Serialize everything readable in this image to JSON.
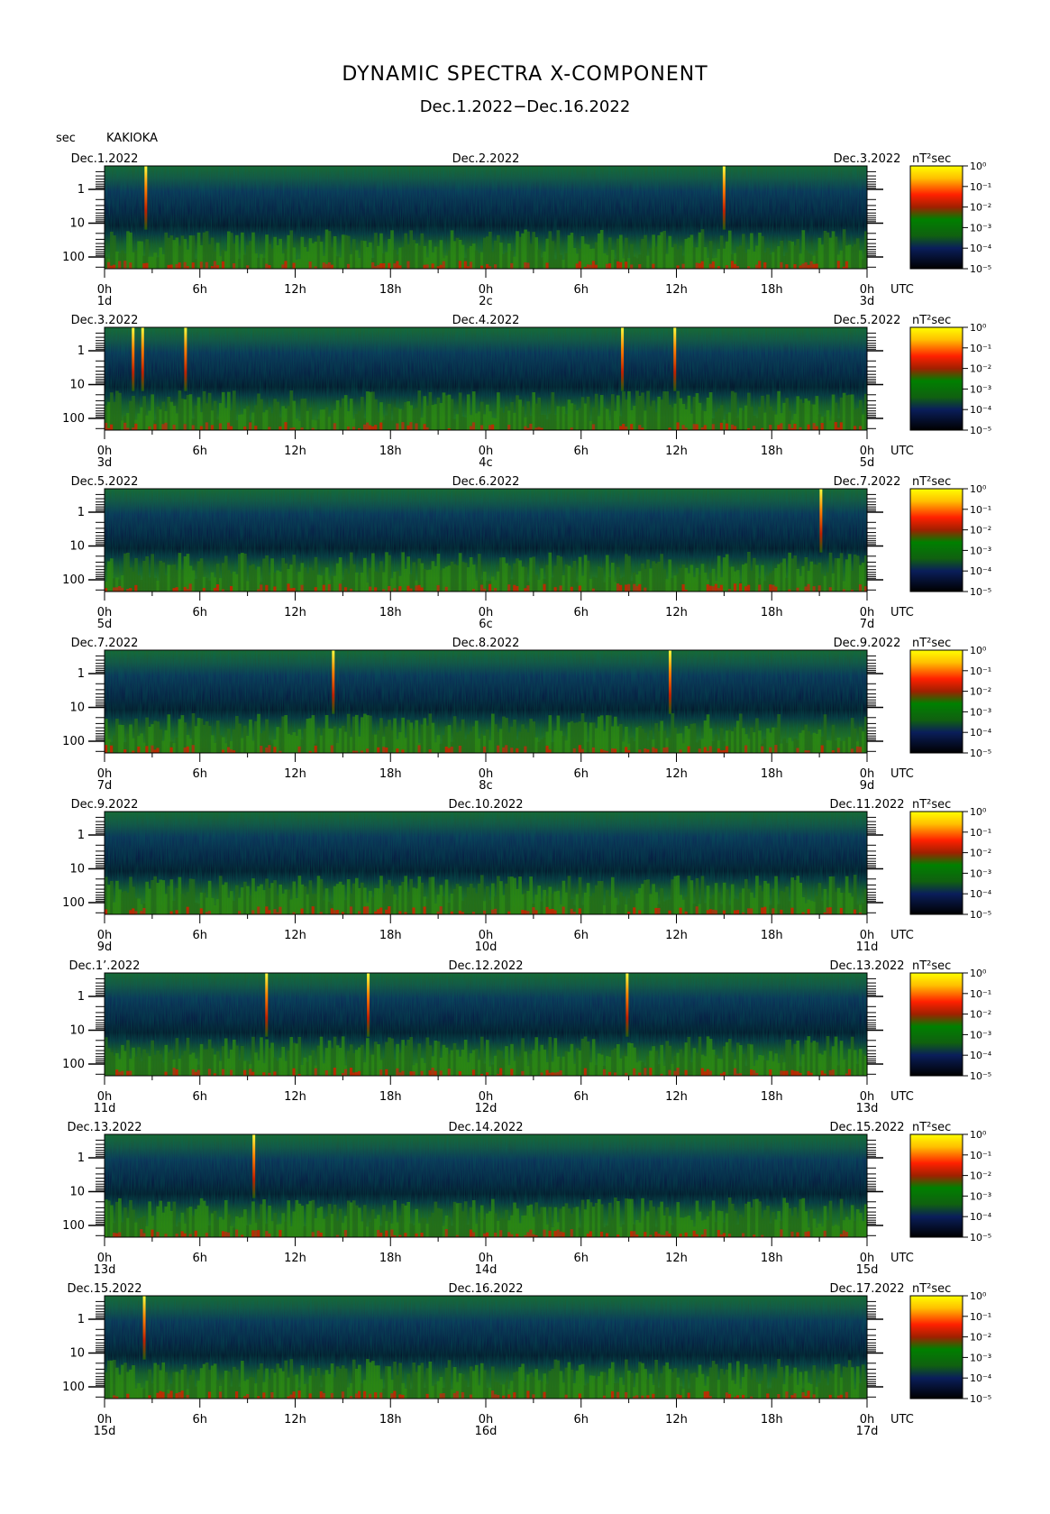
{
  "header": {
    "title": "DYNAMIC SPECTRA X-COMPONENT",
    "subtitle": "Dec.1.2022−Dec.16.2022",
    "y_unit": "sec",
    "station": "KAKIOKA"
  },
  "chart_data": {
    "type": "heatmap",
    "title": "DYNAMIC SPECTRA X-COMPONENT",
    "subtitle": "Dec.1.2022−Dec.16.2022",
    "ylabel": "sec",
    "y_scale": "log",
    "y_ticks": [
      "1",
      "10",
      "100"
    ],
    "x_tick_labels": [
      "0h",
      "6h",
      "12h",
      "18h",
      "0h",
      "6h",
      "12h",
      "18h",
      "0h"
    ],
    "x_unit": "UTC",
    "colorbar": {
      "label": "nT²sec",
      "scale": "log",
      "ticks": [
        "10⁰",
        "10⁻¹",
        "10⁻²",
        "10⁻³",
        "10⁻⁴",
        "10⁻⁵"
      ],
      "colors": [
        "#ffff00",
        "#ff9000",
        "#ff0000",
        "#008000",
        "#0a1a50",
        "#000000"
      ]
    },
    "panels": [
      {
        "start_label": "Dec.1.2022",
        "mid_label": "Dec.2.2022",
        "end_label": "Dec.3.2022",
        "day_start": "1d",
        "day_mid": "2c",
        "day_end": "3d",
        "spikes_hours": [
          2.6,
          39
        ]
      },
      {
        "start_label": "Dec.3.2022",
        "mid_label": "Dec.4.2022",
        "end_label": "Dec.5.2022",
        "day_start": "3d",
        "day_mid": "4c",
        "day_end": "5d",
        "spikes_hours": [
          1.8,
          2.4,
          5.1,
          32.6,
          35.9
        ]
      },
      {
        "start_label": "Dec.5.2022",
        "mid_label": "Dec.6.2022",
        "end_label": "Dec.7.2022",
        "day_start": "5d",
        "day_mid": "6c",
        "day_end": "7d",
        "spikes_hours": [
          45.1
        ]
      },
      {
        "start_label": "Dec.7.2022",
        "mid_label": "Dec.8.2022",
        "end_label": "Dec.9.2022",
        "day_start": "7d",
        "day_mid": "8c",
        "day_end": "9d",
        "spikes_hours": [
          14.4,
          35.6
        ]
      },
      {
        "start_label": "Dec.9.2022",
        "mid_label": "Dec.10.2022",
        "end_label": "Dec.11.2022",
        "day_start": "9d",
        "day_mid": "10d",
        "day_end": "11d",
        "spikes_hours": []
      },
      {
        "start_label": "Dec.1’.2022",
        "mid_label": "Dec.12.2022",
        "end_label": "Dec.13.2022",
        "day_start": "11d",
        "day_mid": "12d",
        "day_end": "13d",
        "spikes_hours": [
          10.2,
          16.6,
          32.9
        ]
      },
      {
        "start_label": "Dec.13.2022",
        "mid_label": "Dec.14.2022",
        "end_label": "Dec.15.2022",
        "day_start": "13d",
        "day_mid": "14d",
        "day_end": "15d",
        "spikes_hours": [
          9.4
        ]
      },
      {
        "start_label": "Dec.15.2022",
        "mid_label": "Dec.16.2022",
        "end_label": "Dec.17.2022",
        "day_start": "15d",
        "day_mid": "16d",
        "day_end": "17d",
        "spikes_hours": [
          2.5
        ]
      }
    ]
  }
}
